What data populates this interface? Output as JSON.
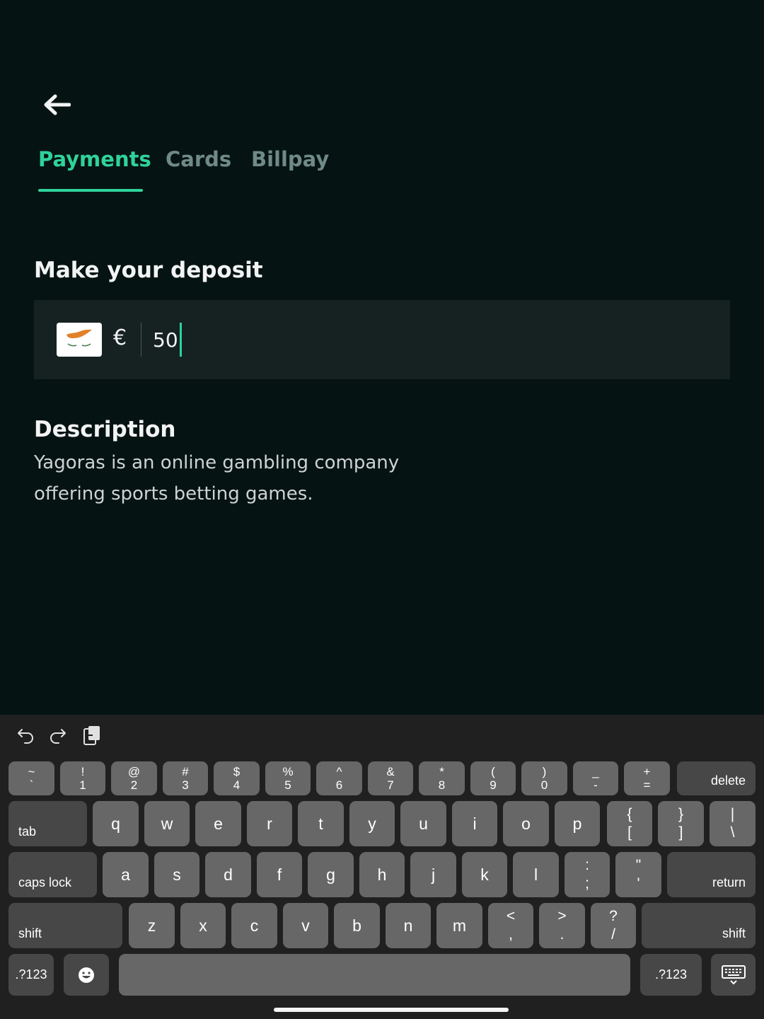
{
  "header": {
    "tabs": [
      {
        "label": "Payments",
        "active": true
      },
      {
        "label": "Cards",
        "active": false
      },
      {
        "label": "Billpay",
        "active": false
      }
    ]
  },
  "deposit": {
    "title": "Make your deposit",
    "currency_symbol": "€",
    "amount": "50",
    "flag": "cyprus-flag"
  },
  "description": {
    "title": "Description",
    "text": "Yagoras is an online gambling company offering sports betting games."
  },
  "colors": {
    "accent": "#2fd39a",
    "background": "#061313",
    "input_background": "#162222"
  },
  "keyboard": {
    "toolbar": [
      "undo-icon",
      "redo-icon",
      "clipboard-icon"
    ],
    "row1": [
      {
        "top": "~",
        "bottom": "`"
      },
      {
        "top": "!",
        "bottom": "1"
      },
      {
        "top": "@",
        "bottom": "2"
      },
      {
        "top": "#",
        "bottom": "3"
      },
      {
        "top": "$",
        "bottom": "4"
      },
      {
        "top": "%",
        "bottom": "5"
      },
      {
        "top": "^",
        "bottom": "6"
      },
      {
        "top": "&",
        "bottom": "7"
      },
      {
        "top": "*",
        "bottom": "8"
      },
      {
        "top": "(",
        "bottom": "9"
      },
      {
        "top": ")",
        "bottom": "0"
      },
      {
        "top": "_",
        "bottom": "-"
      },
      {
        "top": "+",
        "bottom": "="
      }
    ],
    "delete": "delete",
    "tab": "tab",
    "row2": [
      "q",
      "w",
      "e",
      "r",
      "t",
      "y",
      "u",
      "i",
      "o",
      "p"
    ],
    "row2_symbols": [
      {
        "top": "{",
        "bottom": "["
      },
      {
        "top": "}",
        "bottom": "]"
      },
      {
        "top": "|",
        "bottom": "\\"
      }
    ],
    "caps_lock": "caps lock",
    "row3": [
      "a",
      "s",
      "d",
      "f",
      "g",
      "h",
      "j",
      "k",
      "l"
    ],
    "row3_symbols": [
      {
        "top": ":",
        "bottom": ";"
      },
      {
        "top": "\"",
        "bottom": "'"
      }
    ],
    "return": "return",
    "shift": "shift",
    "row4": [
      "z",
      "x",
      "c",
      "v",
      "b",
      "n",
      "m"
    ],
    "row4_symbols": [
      {
        "top": "<",
        "bottom": ","
      },
      {
        "top": ">",
        "bottom": "."
      },
      {
        "top": "?",
        "bottom": "/"
      }
    ],
    "numbers_key": ".?123"
  }
}
